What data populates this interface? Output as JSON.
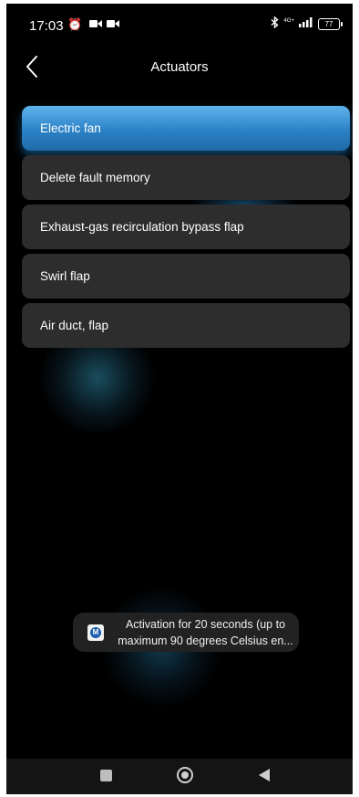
{
  "status_bar": {
    "time": "17:03",
    "left_icons": [
      "alarm-icon",
      "video-icon",
      "video-icon"
    ],
    "right_icons": [
      "bluetooth-icon",
      "network-4g-icon",
      "signal-icon",
      "battery-icon"
    ],
    "network_label": "4G+",
    "battery_level": "77"
  },
  "header": {
    "title": "Actuators",
    "back_icon": "chevron-left-icon"
  },
  "actuators": {
    "items": [
      {
        "label": "Electric fan",
        "selected": true
      },
      {
        "label": "Delete fault memory",
        "selected": false
      },
      {
        "label": "Exhaust-gas recirculation bypass flap",
        "selected": false
      },
      {
        "label": "Swirl flap",
        "selected": false
      },
      {
        "label": "Air duct, flap",
        "selected": false
      }
    ]
  },
  "toast": {
    "icon": "app-logo-icon",
    "line1": "Activation for 20 seconds (up to",
    "line2": "maximum 90 degrees Celsius en..."
  },
  "nav_bar": {
    "buttons": [
      "recents-square-icon",
      "home-circle-icon",
      "back-triangle-icon"
    ]
  },
  "colors": {
    "background": "#000000",
    "item_background": "#2d2d2d",
    "selected_accent": "#2b82c6",
    "toast_background": "#222222"
  }
}
